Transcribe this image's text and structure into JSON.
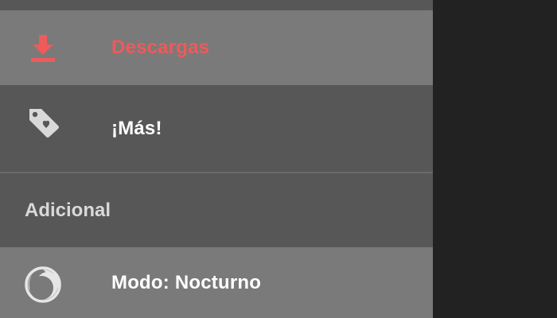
{
  "drawer": {
    "items": [
      {
        "label": "Descargas",
        "icon": "download-icon",
        "color": "#ef5a5a",
        "active": true
      },
      {
        "label": "¡Más!",
        "icon": "tag-heart-icon",
        "color": "#ffffff"
      }
    ],
    "section_header": "Adicional",
    "extra_items": [
      {
        "label": "Modo: Nocturno",
        "icon": "moon-icon",
        "color": "#ffffff"
      }
    ]
  },
  "colors": {
    "accent": "#ef5a5a",
    "drawer_bg": "#575757",
    "highlight_bg": "#7a7a7a",
    "scrim": "#222222"
  }
}
